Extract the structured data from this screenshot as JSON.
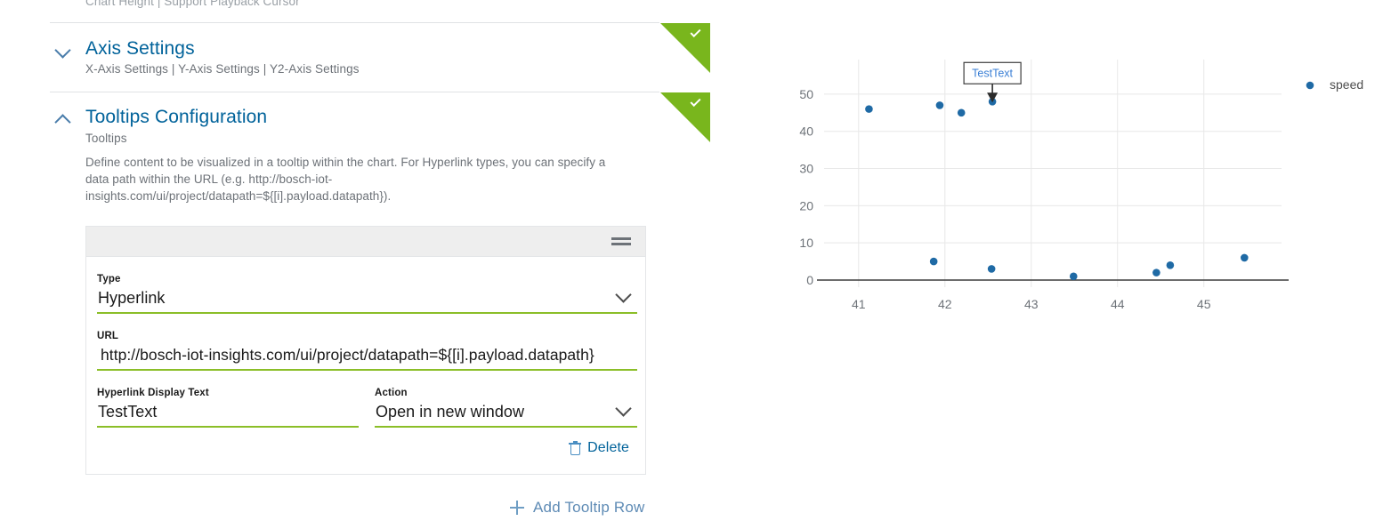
{
  "page": {
    "cut_off_top_text": "Chart Height | Support Playback Cursor"
  },
  "sections": {
    "axis": {
      "title": "Axis Settings",
      "subtitle": "X-Axis Settings | Y-Axis Settings | Y2-Axis Settings",
      "chevron": "chevron-down-icon",
      "status": "complete"
    },
    "tooltips": {
      "title": "Tooltips Configuration",
      "subtitle": "Tooltips",
      "chevron": "chevron-up-icon",
      "status": "complete",
      "description_line1": "Define content to be visualized in a tooltip within the chart. For Hyperlink types, you can specify a",
      "description_line2": "data path within the URL (e.g. http://bosch-iot-",
      "description_line3": "insights.com/ui/project/datapath=${[i].payload.datapath})."
    }
  },
  "tooltip_row": {
    "type": {
      "label": "Type",
      "value": "Hyperlink"
    },
    "url": {
      "label": "URL",
      "value": "http://bosch-iot-insights.com/ui/project/datapath=${[i].payload.datapath}"
    },
    "display_text": {
      "label": "Hyperlink Display Text",
      "value": "TestText"
    },
    "action": {
      "label": "Action",
      "value": "Open in new window"
    },
    "delete_label": "Delete"
  },
  "add_row": {
    "label": "Add Tooltip Row"
  },
  "colors": {
    "accent_blue": "#00629a",
    "green_check": "#79b61d",
    "field_underline": "#8bbe28",
    "series_blue": "#1f6aa5",
    "link_blue": "#3a7fd5"
  },
  "chart_data": {
    "type": "scatter",
    "title": "",
    "xlabel": "",
    "ylabel": "",
    "xlim": [
      40.6,
      45.9
    ],
    "ylim": [
      0,
      55
    ],
    "xticks": [
      41,
      42,
      43,
      44,
      45
    ],
    "yticks": [
      0,
      10,
      20,
      30,
      40,
      50
    ],
    "grid": true,
    "legend_position": "right",
    "series": [
      {
        "name": "speed",
        "color": "#1f6aa5",
        "points": [
          {
            "x": 41.12,
            "y": 46
          },
          {
            "x": 41.87,
            "y": 5
          },
          {
            "x": 41.94,
            "y": 47
          },
          {
            "x": 42.19,
            "y": 45
          },
          {
            "x": 42.55,
            "y": 48
          },
          {
            "x": 42.54,
            "y": 3
          },
          {
            "x": 43.49,
            "y": 1
          },
          {
            "x": 44.45,
            "y": 2
          },
          {
            "x": 44.61,
            "y": 4
          },
          {
            "x": 45.47,
            "y": 6
          }
        ]
      }
    ],
    "annotations": [
      {
        "text": "TestText",
        "x": 42.55,
        "y": 48,
        "kind": "tooltip-callout"
      }
    ]
  }
}
